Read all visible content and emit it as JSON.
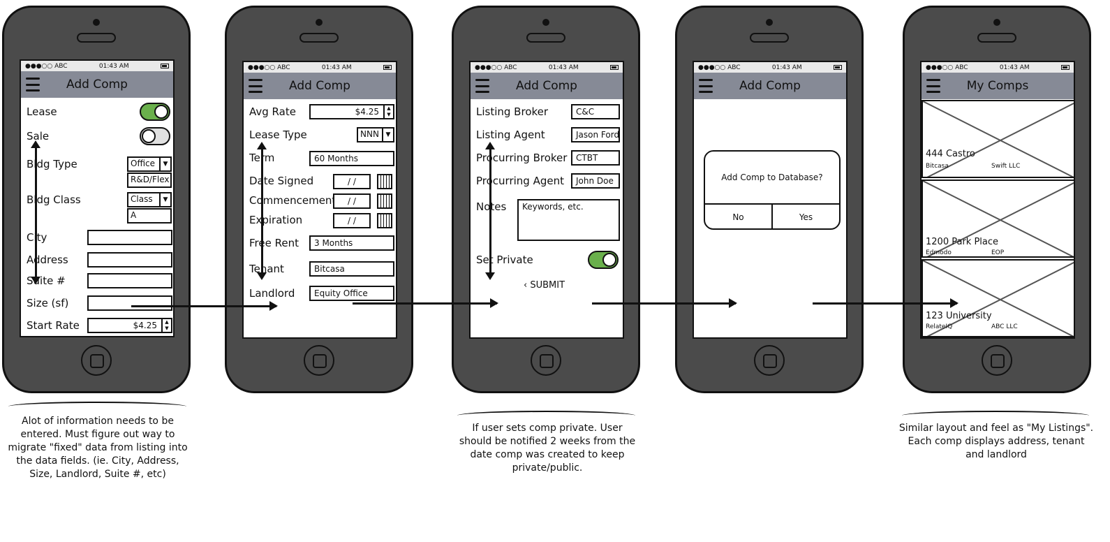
{
  "status": {
    "carrier": "●●●○○ ABC",
    "time": "01:43 AM"
  },
  "phone1": {
    "title": "Add Comp",
    "lease_label": "Lease",
    "sale_label": "Sale",
    "bldg_type_label": "Bldg Type",
    "bldg_type_value": "Office",
    "bldg_type_sub": "R&D/Flex",
    "bldg_class_label": "Bldg Class",
    "bldg_class_value": "Class",
    "bldg_class_sub": "A",
    "city_label": "City",
    "address_label": "Address",
    "suite_label": "Suite #",
    "size_label": "Size (sf)",
    "start_rate_label": "Start Rate",
    "start_rate_value": "$4.25",
    "lease_on": true,
    "sale_on": false
  },
  "phone2": {
    "title": "Add Comp",
    "avg_rate_label": "Avg Rate",
    "avg_rate_value": "$4.25",
    "lease_type_label": "Lease Type",
    "lease_type_value": "NNN",
    "term_label": "Term",
    "term_value": "60 Months",
    "date_signed_label": "Date Signed",
    "commencement_label": "Commencement",
    "expiration_label": "Expiration",
    "date_placeholder": "/ /",
    "free_rent_label": "Free Rent",
    "free_rent_value": "3 Months",
    "tenant_label": "Tenant",
    "tenant_value": "Bitcasa",
    "landlord_label": "Landlord",
    "landlord_value": "Equity Office"
  },
  "phone3": {
    "title": "Add Comp",
    "listing_broker_label": "Listing Broker",
    "listing_broker_value": "C&C",
    "listing_agent_label": "Listing Agent",
    "listing_agent_value": "Jason Ford",
    "procuring_broker_label": "Procurring Broker",
    "procuring_broker_value": "CTBT",
    "procuring_agent_label": "Procurring Agent",
    "procuring_agent_value": "John Doe",
    "notes_label": "Notes",
    "notes_value": "Keywords, etc.",
    "set_private_label": "Set Private",
    "submit_label": "SUBMIT",
    "private_on": true
  },
  "phone4": {
    "title": "Add Comp",
    "dialog_text": "Add Comp to Database?",
    "no_label": "No",
    "yes_label": "Yes"
  },
  "phone5": {
    "title": "My Comps",
    "comps": [
      {
        "address": "444 Castro",
        "tenant": "Bitcasa",
        "landlord": "Swift LLC"
      },
      {
        "address": "1200 Park Place",
        "tenant": "Edmodo",
        "landlord": "EOP"
      },
      {
        "address": "123 University",
        "tenant": "RelateIQ",
        "landlord": "ABC LLC"
      }
    ]
  },
  "captions": {
    "c1": "Alot of information needs to be entered. Must figure out way to migrate \"fixed\" data from listing into the data fields. (ie. City, Address, Size, Landlord, Suite #, etc)",
    "c3": "If user sets comp private. User should be notified 2 weeks from the date comp was created to keep private/public.",
    "c5": "Similar layout and feel as \"My Listings\". Each comp displays address, tenant and landlord"
  },
  "colors": {
    "toggle_on": "#6ab04c",
    "toggle_off": "#e0e0e0",
    "titlebar": "#868a96",
    "phone": "#4b4b4b"
  }
}
